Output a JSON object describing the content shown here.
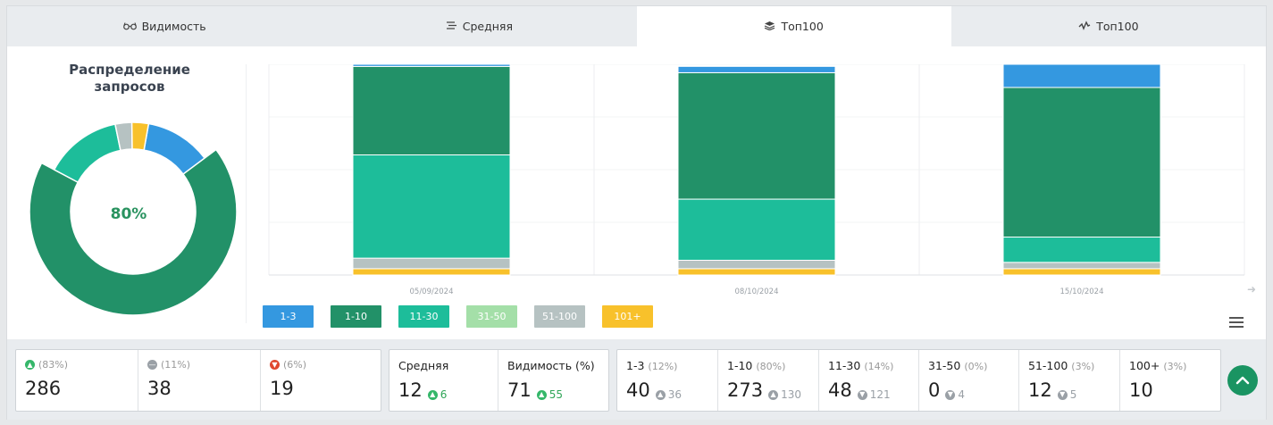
{
  "tabs": [
    {
      "label": "Видимость",
      "icon": "glasses-icon"
    },
    {
      "label": "Средняя",
      "icon": "lines-icon"
    },
    {
      "label": "Топ100",
      "icon": "layers-icon"
    },
    {
      "label": "Топ100",
      "icon": "activity-icon"
    }
  ],
  "active_tab": 2,
  "donut": {
    "title": "Распределение запросов",
    "center_value": "80%"
  },
  "colors": {
    "1-3": "#3498e0",
    "1-10": "#229168",
    "11-30": "#1dbd9a",
    "31-50": "#a4dfa8",
    "51-100": "#b6c2c2",
    "101+": "#f8c12b"
  },
  "legend": [
    "1-3",
    "1-10",
    "11-30",
    "31-50",
    "51-100",
    "101+"
  ],
  "chart_data": [
    {
      "type": "pie",
      "categories": [
        "1-3",
        "1-10",
        "11-30",
        "31-50",
        "51-100",
        "101+"
      ],
      "values": [
        12,
        68,
        14,
        0,
        3,
        3
      ]
    },
    {
      "type": "bar",
      "stacked": true,
      "categories": [
        "05/09/2024",
        "08/10/2024",
        "15/10/2024"
      ],
      "series": [
        {
          "name": "1-3",
          "values": [
            1,
            3,
            11
          ]
        },
        {
          "name": "1-10",
          "values": [
            42,
            60,
            71
          ]
        },
        {
          "name": "11-30",
          "values": [
            49,
            29,
            12
          ]
        },
        {
          "name": "31-50",
          "values": [
            0,
            0,
            0
          ]
        },
        {
          "name": "51-100",
          "values": [
            5,
            4,
            3
          ]
        },
        {
          "name": "101+",
          "values": [
            3,
            3,
            3
          ]
        }
      ],
      "ylim": [
        0,
        100
      ],
      "grid": true
    }
  ],
  "stats_a": [
    {
      "pct": "(83%)",
      "value": "286",
      "dir": "up"
    },
    {
      "pct": "(11%)",
      "value": "38",
      "dir": "same"
    },
    {
      "pct": "(6%)",
      "value": "19",
      "dir": "down"
    }
  ],
  "stats_b": [
    {
      "label": "Средняя",
      "value": "12",
      "change": "6",
      "dir": "up"
    },
    {
      "label": "Видимость (%)",
      "value": "71",
      "change": "55",
      "dir": "up"
    }
  ],
  "stats_c": [
    {
      "label": "1-3",
      "pct": "(12%)",
      "value": "40",
      "change": "36",
      "dir": "up"
    },
    {
      "label": "1-10",
      "pct": "(80%)",
      "value": "273",
      "change": "130",
      "dir": "up"
    },
    {
      "label": "11-30",
      "pct": "(14%)",
      "value": "48",
      "change": "121",
      "dir": "down"
    },
    {
      "label": "31-50",
      "pct": "(0%)",
      "value": "0",
      "change": "4",
      "dir": "down"
    },
    {
      "label": "51-100",
      "pct": "(3%)",
      "value": "12",
      "change": "5",
      "dir": "down"
    },
    {
      "label": "100+",
      "pct": "(3%)",
      "value": "10",
      "change": "",
      "dir": ""
    }
  ]
}
